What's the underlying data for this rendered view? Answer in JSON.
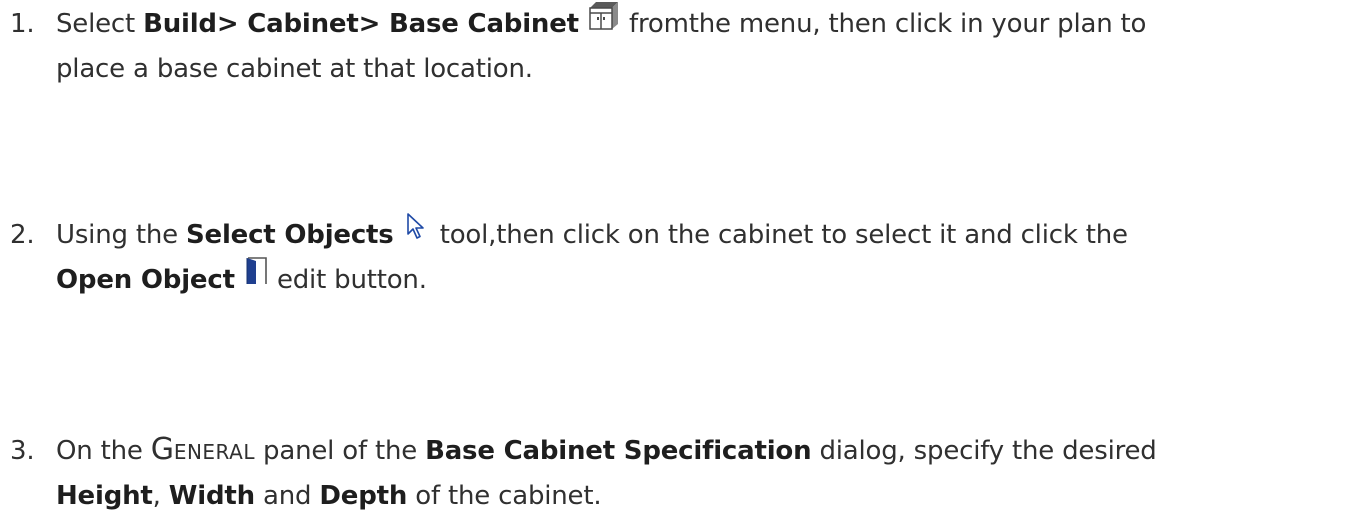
{
  "steps": [
    {
      "number": "1.",
      "p1": "Select ",
      "bold1": "Build> Cabinet> Base Cabinet",
      "icon": "base-cabinet-icon",
      "p2": " fromthe menu, then click in your plan to",
      "line2": "place a base cabinet at that location."
    },
    {
      "number": "2.",
      "p1": "Using the ",
      "bold1": "Select Objects",
      "icon": "select-arrow-icon",
      "p2": " tool,then click on the cabinet to select it and click the",
      "bold2": "Open Object",
      "icon2": "open-object-icon",
      "p3": " edit button."
    },
    {
      "number": "3.",
      "p1": "On the ",
      "panel_cap": "G",
      "panel_rest": "ENERAL",
      "p2": " panel of the ",
      "bold1": "Base Cabinet Specification",
      "p3": " dialog, specify the desired",
      "bold2": "Height",
      "p4": ", ",
      "bold3": "Width",
      "p5": " and ",
      "bold4": "Depth",
      "p6": " of the cabinet."
    }
  ],
  "colors": {
    "text": "#303030",
    "icon_blue": "#1f3f8f"
  }
}
